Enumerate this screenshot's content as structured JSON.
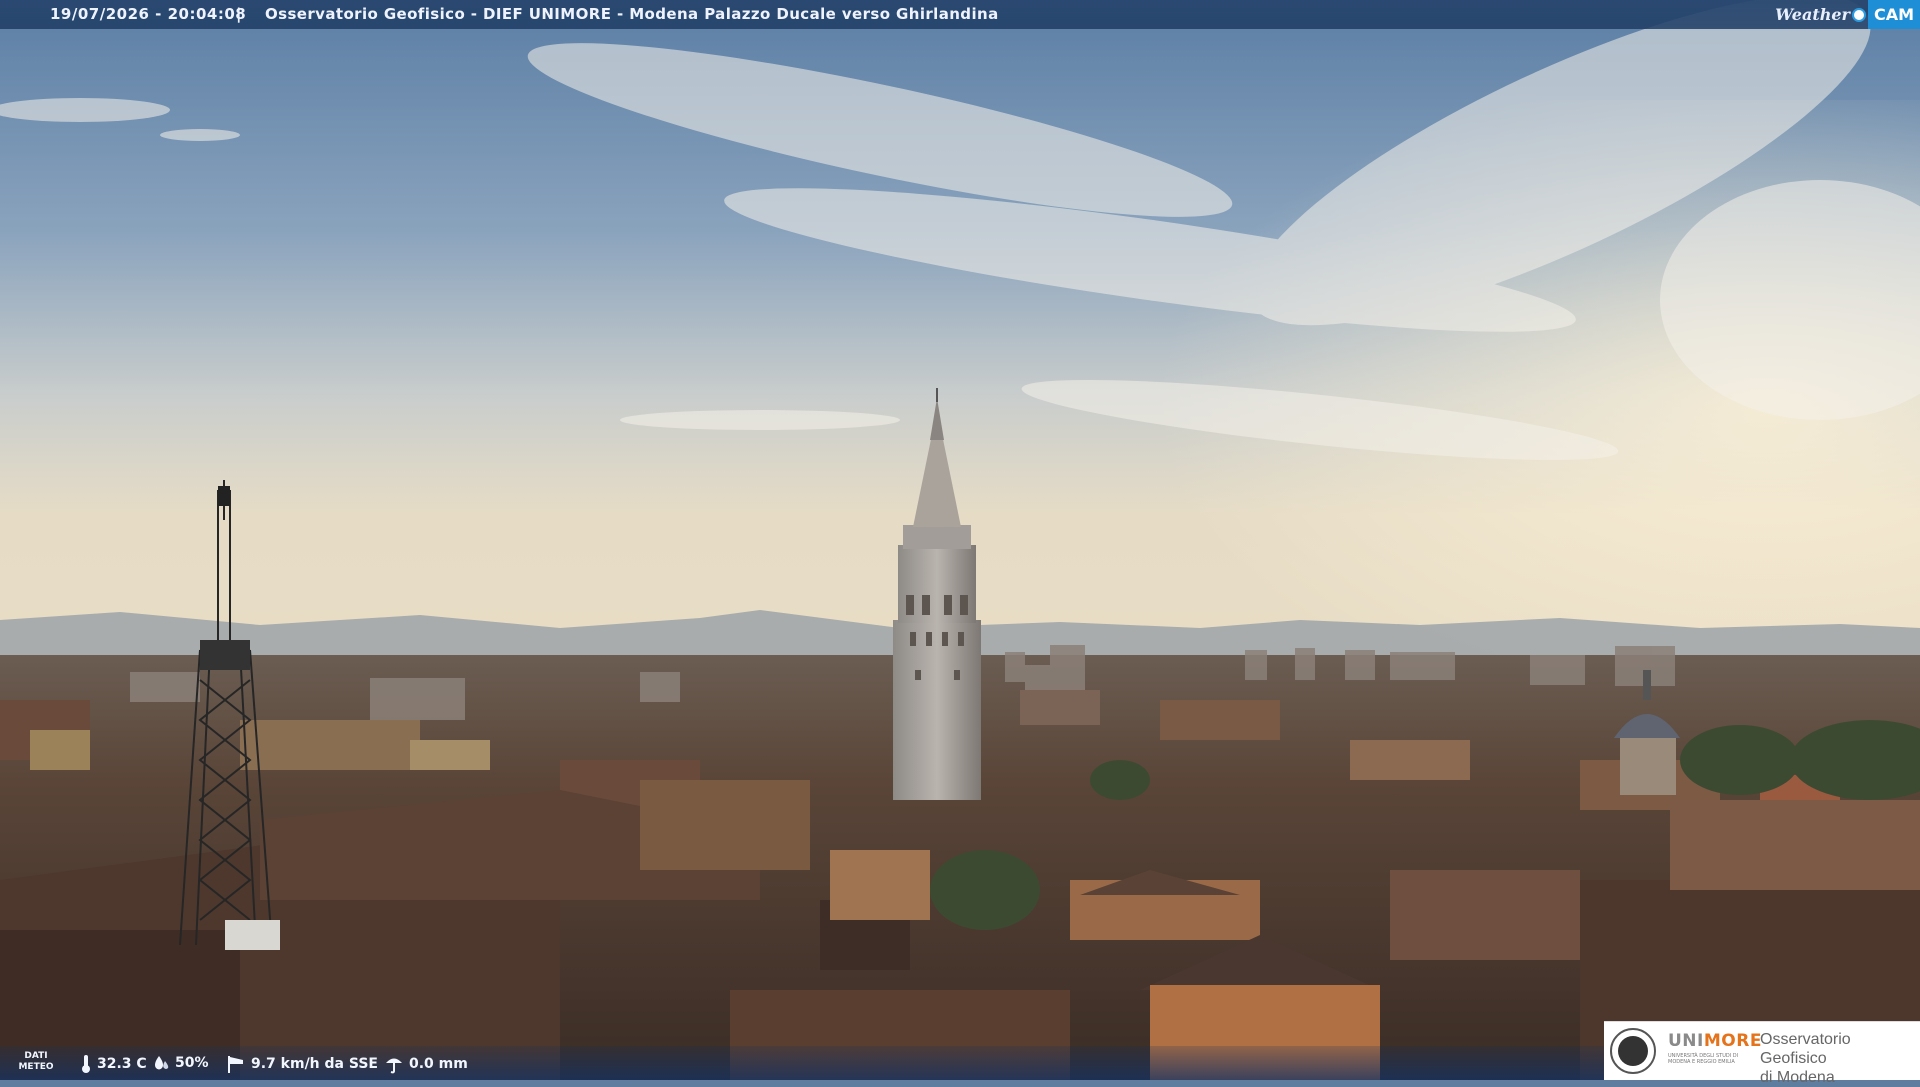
{
  "header": {
    "timestamp": "19/07/2026 - 20:04:08",
    "separator": "|",
    "title": "Osservatorio Geofisico - DIEF UNIMORE - Modena Palazzo Ducale verso Ghirlandina",
    "logo": {
      "weather": "Weather",
      "cam": "CAM",
      "accent": "#1e8fd6"
    }
  },
  "weather_bar": {
    "label_line1": "DATI",
    "label_line2": "METEO",
    "temperature": "32.3 C",
    "humidity": "50%",
    "wind": "9.7 km/h da SSE",
    "rain": "0.0 mm",
    "icons": [
      "thermometer-icon",
      "humidity-drop-icon",
      "wind-sock-icon",
      "rain-gauge-icon"
    ]
  },
  "partner_logo": {
    "brand_part1": "UNI",
    "brand_part2": "MORE",
    "brand_sub": "Università degli Studi di Modena e Reggio Emilia",
    "obs_line1": "Osservatorio Geofisico",
    "obs_line2": "di Modena",
    "brand_color": "#e4731b"
  },
  "scene": {
    "description_colors": {
      "sky_top": "#5d7fa4",
      "sky_horizon": "#e9e0c8",
      "roofs": "#4a3a30"
    }
  }
}
